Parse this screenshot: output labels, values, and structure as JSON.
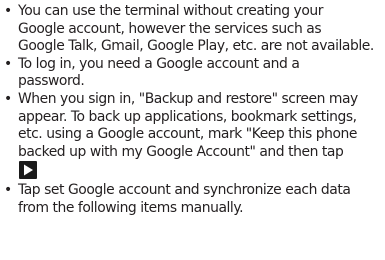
{
  "bullet_symbol": "•",
  "items": [
    {
      "lines": [
        "You can use the terminal without creating your",
        "Google account, however the services such as",
        "Google Talk, Gmail, Google Play, etc. are not available."
      ]
    },
    {
      "lines": [
        "To log in, you need a Google account and a",
        "password."
      ]
    },
    {
      "lines": [
        "When you sign in, \"Backup and restore\" screen may",
        "appear. To back up applications, bookmark settings,",
        "etc. using a Google account, mark \"Keep this phone",
        "backed up with my Google Account\" and then tap"
      ],
      "trailing_icon": "next-arrow-icon"
    },
    {
      "lines": [
        "Tap set Google account and synchronize each data",
        "from the following items manually."
      ]
    }
  ],
  "colors": {
    "text": "#231f20",
    "icon_background": "#1a1a1a",
    "icon_arrow": "#ffffff"
  }
}
